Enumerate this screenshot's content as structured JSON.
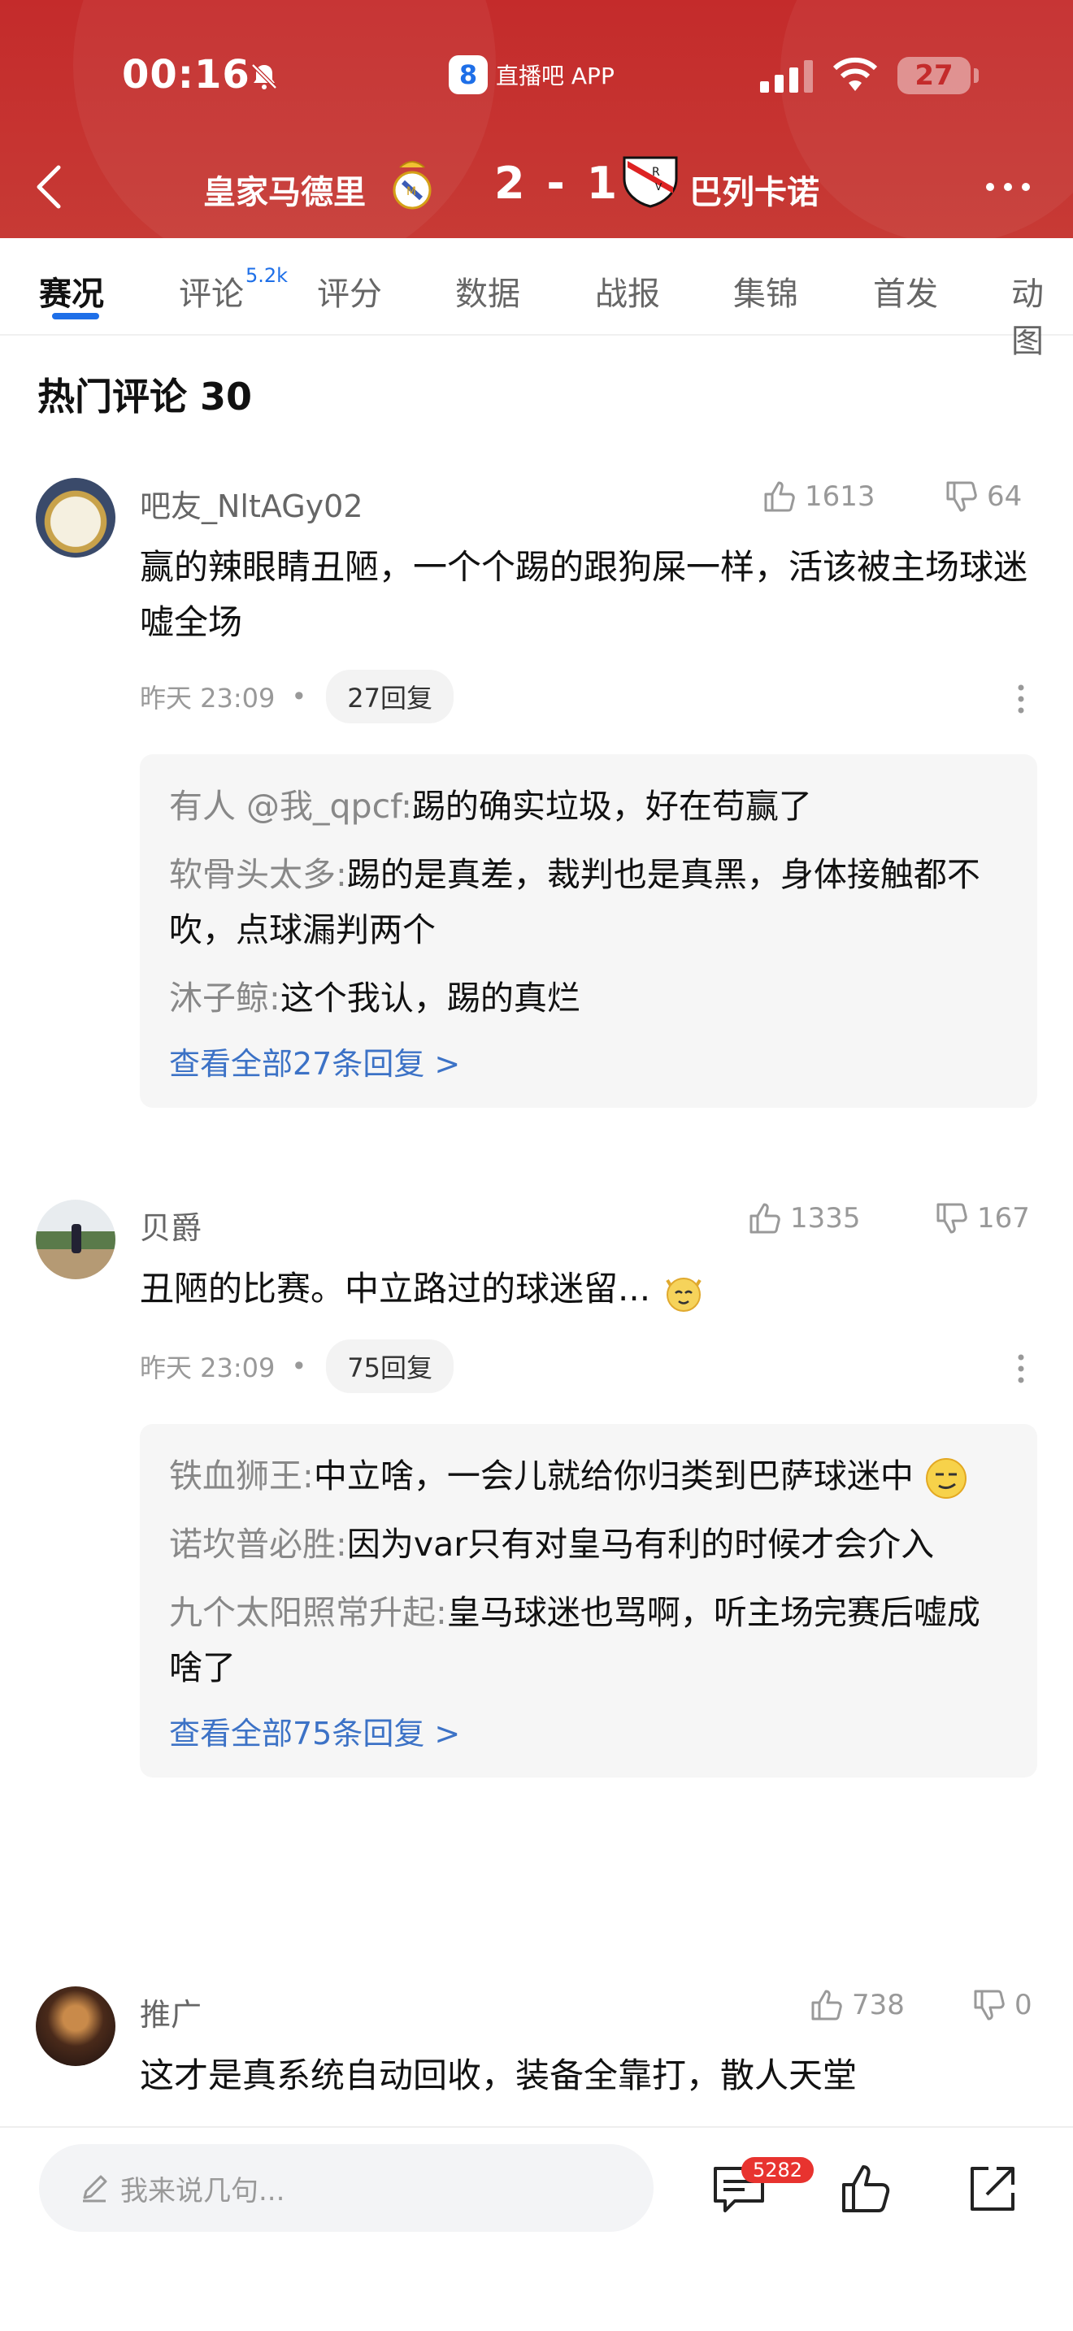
{
  "status_bar": {
    "time": "00:16",
    "app_name": "直播吧 APP",
    "app_icon_text": "8",
    "battery": "27"
  },
  "header": {
    "home_team": "皇家马德里",
    "score": "2 - 1",
    "away_team": "巴列卡诺"
  },
  "tabs": [
    {
      "label": "赛况",
      "active": true
    },
    {
      "label": "评论",
      "badge": "5.2k"
    },
    {
      "label": "评分"
    },
    {
      "label": "数据"
    },
    {
      "label": "战报"
    },
    {
      "label": "集锦"
    },
    {
      "label": "首发"
    },
    {
      "label": "动图"
    }
  ],
  "section_title": "热门评论 30",
  "comments": [
    {
      "user": "吧友_NltAGy02",
      "likes": "1613",
      "dislikes": "64",
      "text": "赢的辣眼睛丑陋，一个个踢的跟狗屎一样，活该被主场球迷嘘全场",
      "time": "昨天 23:09",
      "reply_count": "27回复",
      "replies": [
        {
          "user": "有人 @我_qpcf",
          "text": "踢的确实垃圾，好在苟赢了"
        },
        {
          "user": "软骨头太多",
          "text": "踢的是真差，裁判也是真黑，身体接触都不吹，点球漏判两个"
        },
        {
          "user": "沐子鲸",
          "text": "这个我认，踢的真烂"
        }
      ],
      "view_all": "查看全部27条回复 >"
    },
    {
      "user": "贝爵",
      "likes": "1335",
      "dislikes": "167",
      "text": "丑陋的比赛。中立路过的球迷留...",
      "time": "昨天 23:09",
      "reply_count": "75回复",
      "replies": [
        {
          "user": "铁血狮王",
          "text": "中立啥，一会儿就给你归类到巴萨球迷中"
        },
        {
          "user": "诺坎普必胜",
          "text": "因为var只有对皇马有利的时候才会介入"
        },
        {
          "user": "九个太阳照常升起",
          "text": "皇马球迷也骂啊，听主场完赛后嘘成啥了"
        }
      ],
      "view_all": "查看全部75条回复 >"
    },
    {
      "user": "推广",
      "likes": "738",
      "dislikes": "0",
      "text": "这才是真系统自动回收，装备全靠打，散人天堂"
    }
  ],
  "bottom_bar": {
    "input_placeholder": "我来说几句...",
    "comment_count": "5282"
  },
  "colors": {
    "header_red": "#c42b2b",
    "accent_blue": "#1e6fe8",
    "link_blue": "#3c72c6",
    "badge_red": "#e8332f"
  }
}
